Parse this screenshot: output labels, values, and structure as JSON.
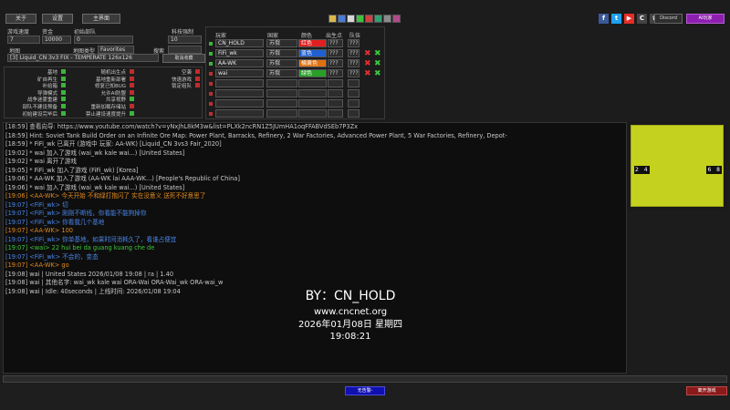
{
  "toolbar": {
    "btn1": "关于",
    "btn2": "设置",
    "btn3": "主界面"
  },
  "swatches": [
    "#d8b94a",
    "#4a7ad8",
    "#d8d8d8",
    "#3fc13f",
    "#d04040",
    "#30a070",
    "#8a8a8a",
    "#b04a8a"
  ],
  "social": [
    {
      "icon": "facebook-icon",
      "glyph": "f",
      "bg": "#3b5998"
    },
    {
      "icon": "twitter-icon",
      "glyph": "t",
      "bg": "#1da1f2"
    },
    {
      "icon": "youtube-icon",
      "glyph": "▶",
      "bg": "#e52d27"
    },
    {
      "icon": "cncnet-icon",
      "glyph": "C",
      "bg": "#444"
    },
    {
      "icon": "trophy-icon",
      "glyph": "♛",
      "bg": "#444"
    }
  ],
  "discord_label": "Discord",
  "ai_label": "AI玩家",
  "settings": {
    "speed_label": "游戏速度",
    "speed_value": "7",
    "credits_label": "资金",
    "credits_value": "10000",
    "units_label": "初始部队",
    "units_value": "0",
    "tech_label": "科技强制",
    "tech_value": "10",
    "map_label": "地图",
    "maptype_label": "地图类型",
    "maptype_value": "Favorites",
    "search_label": "搜索",
    "map_value": "[3] Liquid_CN 3v3 FIX - TEMPERATE 126x126",
    "map_button": "取消收藏"
  },
  "options": {
    "col1": [
      {
        "label": "基地",
        "on": true
      },
      {
        "label": "矿自再生",
        "on": true
      },
      {
        "label": "补给箱",
        "on": true
      },
      {
        "label": "导弹模式",
        "on": true
      },
      {
        "label": "战争迷雾重建",
        "on": true
      },
      {
        "label": "部队不建设预备",
        "on": true
      },
      {
        "label": "初始建设完毕后",
        "on": true
      }
    ],
    "col2": [
      {
        "label": "随机出生点",
        "on": false
      },
      {
        "label": "基地重新部署",
        "on": false
      },
      {
        "label": "修复已知BUG",
        "on": false
      },
      {
        "label": "允许AI防盟",
        "on": false
      },
      {
        "label": "共享视野",
        "on": true
      },
      {
        "label": "重新加载存储站",
        "on": false
      },
      {
        "label": "禁止建设速度提升",
        "on": true
      }
    ],
    "col3": [
      {
        "label": "空袭",
        "on": false
      },
      {
        "label": "快速游戏",
        "on": false
      },
      {
        "label": "锁定组队",
        "on": false
      }
    ]
  },
  "players": {
    "headers": {
      "player": "玩家",
      "side": "国家",
      "color": "颜色",
      "start": "出生点",
      "team": "队伍"
    },
    "rows": [
      {
        "name": "CN_HOLD",
        "side": "苏俄",
        "color": "红色",
        "color_hex": "#e02020",
        "start": "???",
        "team": "???",
        "status": "#3cb43c",
        "kick": false
      },
      {
        "name": "FiFi_wk",
        "side": "苏俄",
        "color": "蓝色",
        "color_hex": "#1f5fd0",
        "start": "???",
        "team": "???",
        "status": "#3cb43c",
        "kick": true
      },
      {
        "name": "AA-WK",
        "side": "苏俄",
        "color": "橘黄色",
        "color_hex": "#e07010",
        "start": "???",
        "team": "???",
        "status": "#3cb43c",
        "kick": true
      },
      {
        "name": "wai",
        "side": "苏俄",
        "color": "绿色",
        "color_hex": "#28a028",
        "start": "???",
        "team": "???",
        "status": "#c02c2c",
        "kick": true
      },
      {
        "name": "",
        "side": "",
        "color": "",
        "color_hex": "#2d2d2d",
        "start": "",
        "team": "",
        "status": "#c02c2c",
        "kick": false
      },
      {
        "name": "",
        "side": "",
        "color": "",
        "color_hex": "#2d2d2d",
        "start": "",
        "team": "",
        "status": "#c02c2c",
        "kick": false
      },
      {
        "name": "",
        "side": "",
        "color": "",
        "color_hex": "#2d2d2d",
        "start": "",
        "team": "",
        "status": "#c02c2c",
        "kick": false
      },
      {
        "name": "",
        "side": "",
        "color": "",
        "color_hex": "#2d2d2d",
        "start": "",
        "team": "",
        "status": "#c02c2c",
        "kick": false
      }
    ]
  },
  "chat": [
    {
      "t": "[18:59] 查看向导: https://www.youtube.com/watch?v=yNxJhL8kM3w&list=PLXk2ncRN1Z5JUmHA1oqFFABVdSEb7P3Zx",
      "c": "#c8c8c8"
    },
    {
      "t": "[18:59] Hint: Soviet Tank Build Order on an Infinite Ore Map: Power Plant, Barracks, Refinery, 2 War Factories, Advanced Power Plant, 5 War Factories, Refinery, Depot-",
      "c": "#c8c8c8"
    },
    {
      "t": "[18:59] * FiFi_wk 已离开 (游戏中 玩家: AA-WK) [Liquid_CN  3vs3  Fair_2020]",
      "c": "#c8c8c8"
    },
    {
      "t": "[19:02] * wai 加入了游戏 (wai_wk kale wai...) [United States]",
      "c": "#c8c8c8"
    },
    {
      "t": "[19:02] * wai 离开了游戏",
      "c": "#c8c8c8"
    },
    {
      "t": "[19:05] * FiFi_wk 加入了游戏 (FiFi_wk) [Korea]",
      "c": "#c8c8c8"
    },
    {
      "t": "[19:06] * AA-WK 加入了游戏 (AA-WK lai AAA-WK...) [People's Republic of China]",
      "c": "#c8c8c8"
    },
    {
      "t": "[19:06] * wai 加入了游戏 (wai_wk kale wai...) [United States]",
      "c": "#c8c8c8"
    },
    {
      "t": "[19:06] <AA-WK> 今天开始  不和绿打抱闪了  实在没意义  送死不好意思了",
      "c": "#e08a20"
    },
    {
      "t": "[19:07] <FiFi_wk> 切",
      "c": "#4a86e8"
    },
    {
      "t": "[19:07] <FiFi_wk> 刚刚不断线，你看能不能狗掉你",
      "c": "#4a86e8"
    },
    {
      "t": "[19:07] <FiFi_wk> 你看我几个基地",
      "c": "#4a86e8"
    },
    {
      "t": "[19:07] <AA-WK> 100",
      "c": "#e08a20"
    },
    {
      "t": "[19:07] <FiFi_wk> 你单基地，如果时间消耗久了，看谁占便宜",
      "c": "#4a86e8"
    },
    {
      "t": "[19:07] <wai> 22 hui bei da guang kuang che de",
      "c": "#3cc83c"
    },
    {
      "t": "[19:07] <FiFi_wk> 不会的，变态",
      "c": "#4a86e8"
    },
    {
      "t": "[19:07] <AA-WK> go",
      "c": "#e08a20"
    },
    {
      "t": "[19:08] wai | United States 2026/01/08 19:08 | ra | 1.40",
      "c": "#c8c8c8"
    },
    {
      "t": "[19:08] wai | 其他名字: wai_wk kale wai ORA-Wai ORA-Wai_wk ORA-wai_w",
      "c": "#c8c8c8"
    },
    {
      "t": "[19:08] wai | Idle: 40seconds | 上线时间: 2026/01/08 19:04",
      "c": "#c8c8c8"
    }
  ],
  "overlay": {
    "line1": "BY：CN_HOLD",
    "line2": "www.cncnet.org",
    "line3": "2026年01月08日 星期四 19:08:21"
  },
  "preview": {
    "spots_left": "2 4",
    "spots_right": "6 8",
    "map_color": "#c5d11f"
  },
  "bottom": {
    "ready": "无告警-",
    "leave": "离开游戏"
  }
}
